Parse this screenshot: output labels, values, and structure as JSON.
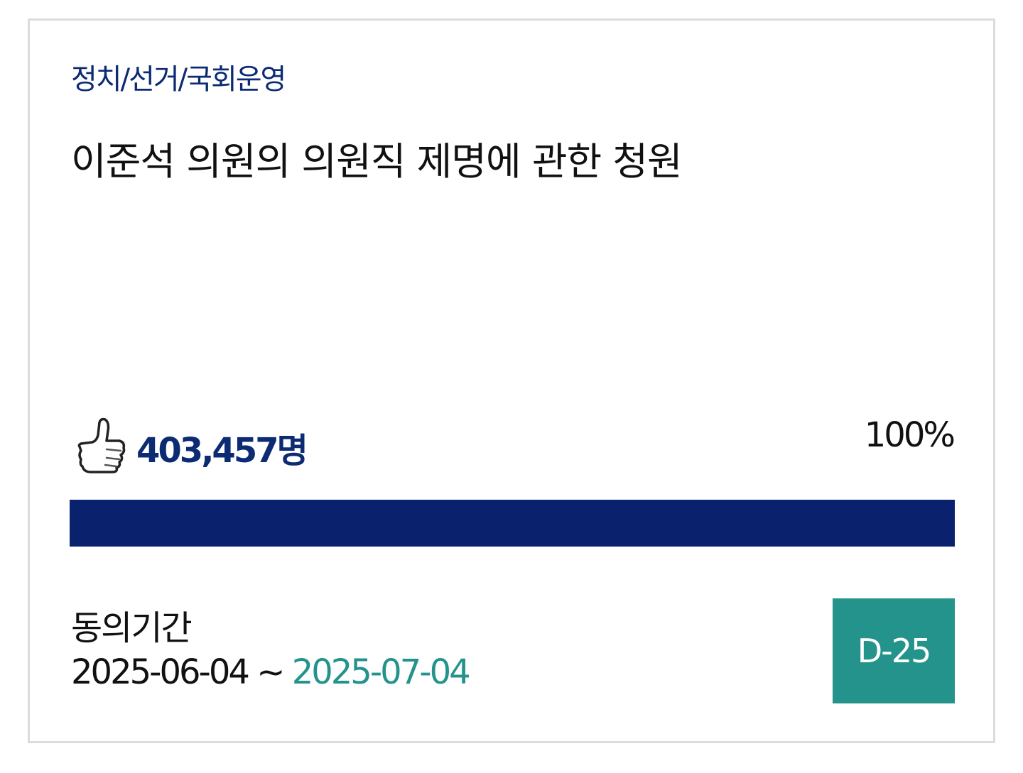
{
  "petition": {
    "category": "정치/선거/국회운영",
    "title": "이준석 의원의 의원직 제명에 관한 청원",
    "agree_count": "403,457명",
    "percent_label": "100%",
    "progress_fraction": 1.0,
    "period_label": "동의기간",
    "start_date": "2025-06-04",
    "separator": " ~ ",
    "end_date": "2025-07-04",
    "dday": "D-25"
  },
  "icons": {
    "agree": "thumbs-up-icon"
  },
  "colors": {
    "navy": "#0c2b73",
    "progress": "#0a216d",
    "teal": "#24938c"
  }
}
